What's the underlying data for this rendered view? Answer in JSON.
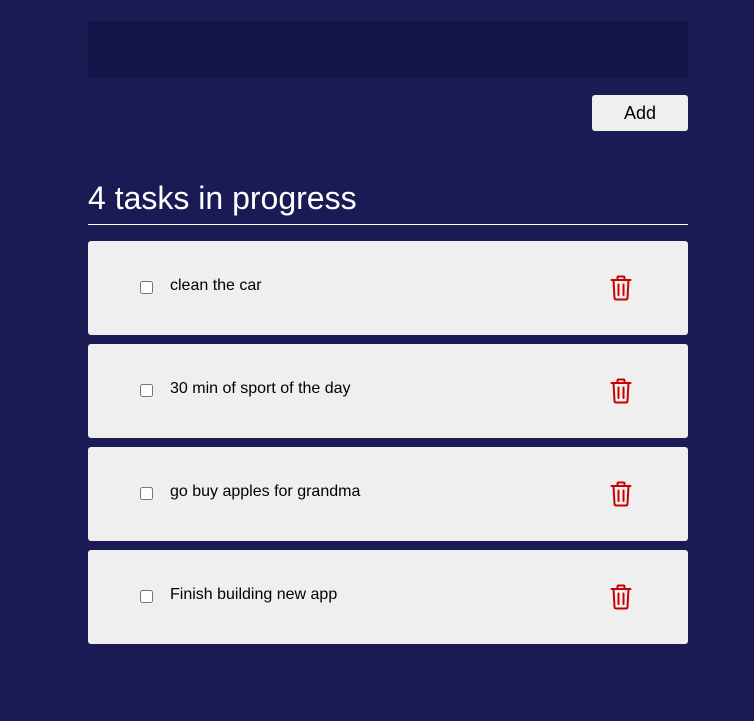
{
  "input": {
    "value": "",
    "placeholder": ""
  },
  "toolbar": {
    "add_label": "Add"
  },
  "heading": "4 tasks in progress",
  "tasks": [
    {
      "label": "clean the car",
      "checked": false
    },
    {
      "label": "30 min of sport of the day",
      "checked": false
    },
    {
      "label": "go buy apples for grandma",
      "checked": false
    },
    {
      "label": "Finish building new app",
      "checked": false
    }
  ],
  "icons": {
    "delete": "trash-icon"
  },
  "colors": {
    "background": "#1a1b55",
    "input_background": "#141448",
    "card": "#efefef",
    "delete_icon": "#c80000",
    "heading_text": "#ffffff"
  }
}
